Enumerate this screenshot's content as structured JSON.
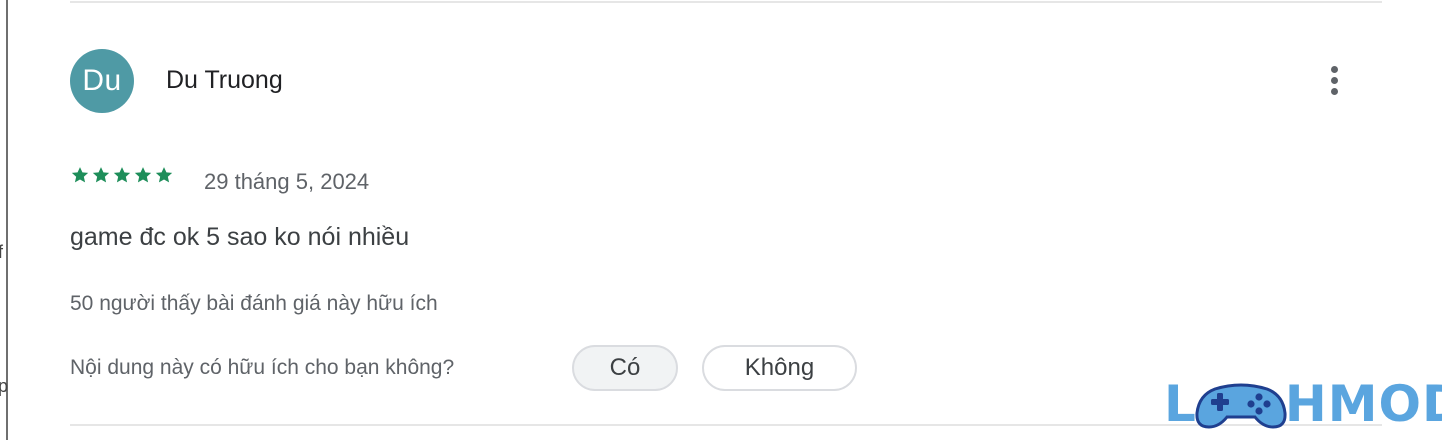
{
  "review": {
    "avatar_initials": "Du",
    "author": "Du Truong",
    "rating": 5,
    "date": "29 tháng 5, 2024",
    "text": "game đc ok 5 sao ko nói nhiều",
    "helpful_count_text": "50 người thấy bài đánh giá này hữu ích",
    "helpful_question": "Nội dung này có hữu ích cho bạn không?",
    "yes_label": "Có",
    "no_label": "Không"
  },
  "watermark": {
    "text_left": "L",
    "text_right": "HMOD"
  },
  "colors": {
    "avatar_bg": "#4f9aa5",
    "star": "#1e8e5a",
    "watermark": "#5aa5df"
  },
  "icons": {
    "more": "more-vert-icon",
    "star": "star-icon",
    "gamepad": "gamepad-icon"
  }
}
